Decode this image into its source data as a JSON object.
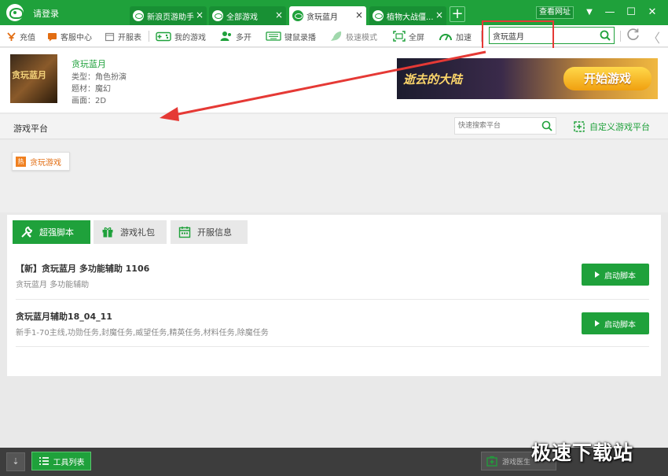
{
  "titlebar": {
    "login": "请登录",
    "tabs": [
      {
        "label": "新浪页游助手",
        "active": false
      },
      {
        "label": "全部游戏",
        "active": false
      },
      {
        "label": "贪玩蓝月",
        "active": true
      },
      {
        "label": "植物大战僵...",
        "active": false
      }
    ],
    "add_tab": "+",
    "view_site": "查看网址",
    "controls": {
      "menu": "▼",
      "minimize": "—",
      "maximize": "☐",
      "close": "✕"
    }
  },
  "toolbar": {
    "items": [
      "充值",
      "客服中心",
      "开服表",
      "我的游戏",
      "多开",
      "键鼠录播",
      "极速模式",
      "全屏",
      "加速"
    ],
    "search_value": "贪玩蓝月",
    "icons": {
      "search": "search-icon",
      "refresh": "refresh-icon",
      "back": "back-icon"
    }
  },
  "game": {
    "thumb_text": "贪玩蓝月",
    "title": "贪玩蓝月",
    "type": "类型：角色扮演",
    "theme": "题材：魔幻",
    "graphics": "画面：2D",
    "banner_text": "逝去的大陆",
    "start_label": "开始游戏"
  },
  "platform": {
    "title": "游戏平台",
    "search_placeholder": "快速搜索平台",
    "custom_label": "自定义游戏平台",
    "chip_badge": "热",
    "chip_label": "贪玩游戏"
  },
  "scripts": {
    "tabs": [
      "超强脚本",
      "游戏礼包",
      "开服信息"
    ],
    "rows": [
      {
        "title": "【新】贪玩蓝月 多功能辅助 1106",
        "subtitle": "贪玩蓝月 多功能辅助",
        "button": "启动脚本"
      },
      {
        "title": "贪玩蓝月辅助18_04_11",
        "subtitle": "新手1-70主线,功勋任务,封魔任务,威望任务,精英任务,材料任务,除魔任务",
        "button": "启动脚本"
      }
    ]
  },
  "bottombar": {
    "collapse": "⇣",
    "tools_label": "工具列表",
    "doctor_label": "游戏医生"
  },
  "watermark": "极速下载站",
  "colors": {
    "brand": "#1fa13b",
    "annotation": "#e53935",
    "platform_accent": "#f08020"
  }
}
